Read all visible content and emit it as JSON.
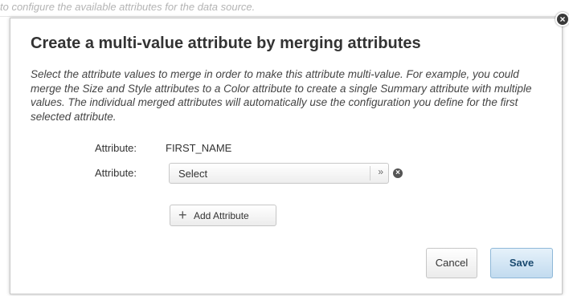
{
  "background": {
    "text": "to configure the available attributes for the data source."
  },
  "dialog": {
    "title": "Create a multi-value attribute by merging attributes",
    "description": "Select the attribute values to merge in order to make this attribute multi-value. For example, you could merge the Size and Style attributes to a Color attribute to create a single Summary attribute with multiple values. The individual merged attributes will automatically use the configuration you define for the first selected attribute.",
    "rows": [
      {
        "label": "Attribute:",
        "value": "FIRST_NAME"
      },
      {
        "label": "Attribute:",
        "select_value": "Select"
      }
    ],
    "add_button_label": "Add Attribute",
    "cancel_label": "Cancel",
    "save_label": "Save"
  },
  "icons": {
    "close": "close-icon",
    "remove": "remove-icon",
    "dropdown": "double-chevron-down-icon",
    "add": "plus-icon"
  },
  "colors": {
    "save_button_bg": "#c2dbef",
    "save_button_text": "#1a4a70",
    "close_button_bg": "#3a3a3a"
  }
}
